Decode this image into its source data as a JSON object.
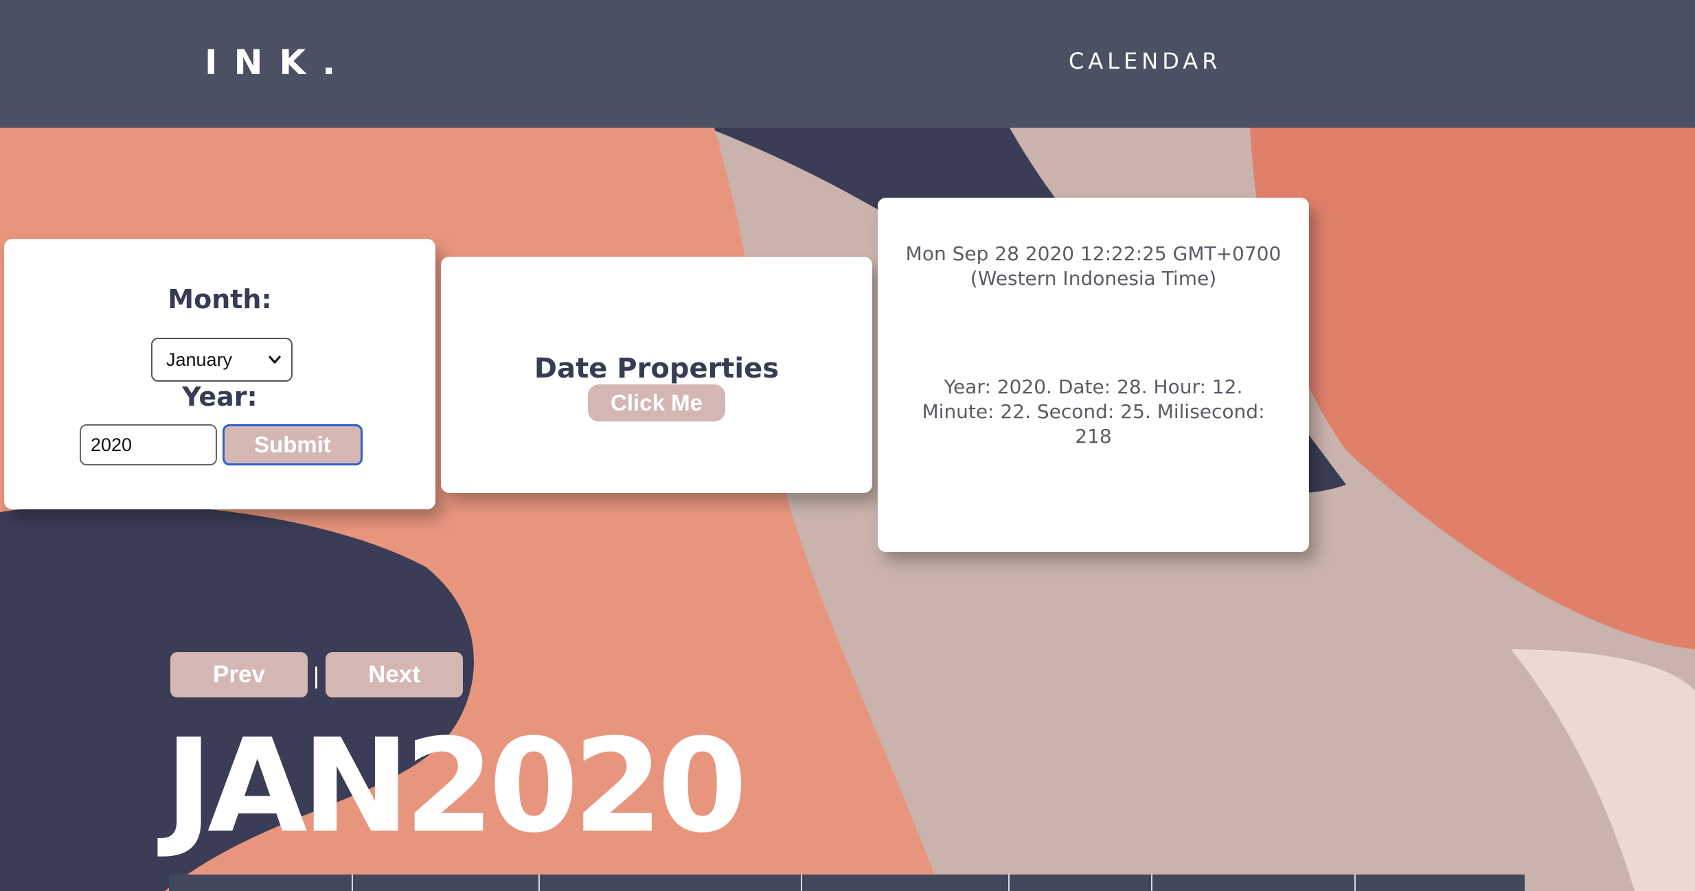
{
  "header": {
    "logo": "INK.",
    "nav_calendar": "CALENDAR"
  },
  "form": {
    "month_label": "Month:",
    "month_selected": "January",
    "year_label": "Year:",
    "year_value": "2020",
    "submit_label": "Submit"
  },
  "properties": {
    "title": "Date Properties",
    "button_label": "Click Me"
  },
  "info": {
    "date_string": "Mon Sep 28 2020 12:22:25 GMT+0700 (Western Indonesia Time)",
    "properties_string": "Year: 2020. Date: 28. Hour: 12. Minute: 22. Second: 25. Milisecond: 218"
  },
  "calendar": {
    "prev_label": "Prev",
    "separator": "|",
    "next_label": "Next",
    "title": "JAN2020"
  },
  "colors": {
    "header_bg": "#4b5063",
    "navy": "#3a3d55",
    "salmon": "#e8957e",
    "beige": "#c9b3ac",
    "button": "#d4b7b3",
    "submit_border": "#2e5fc8"
  },
  "icons": {
    "select_chevron": "chevron-down-icon"
  }
}
